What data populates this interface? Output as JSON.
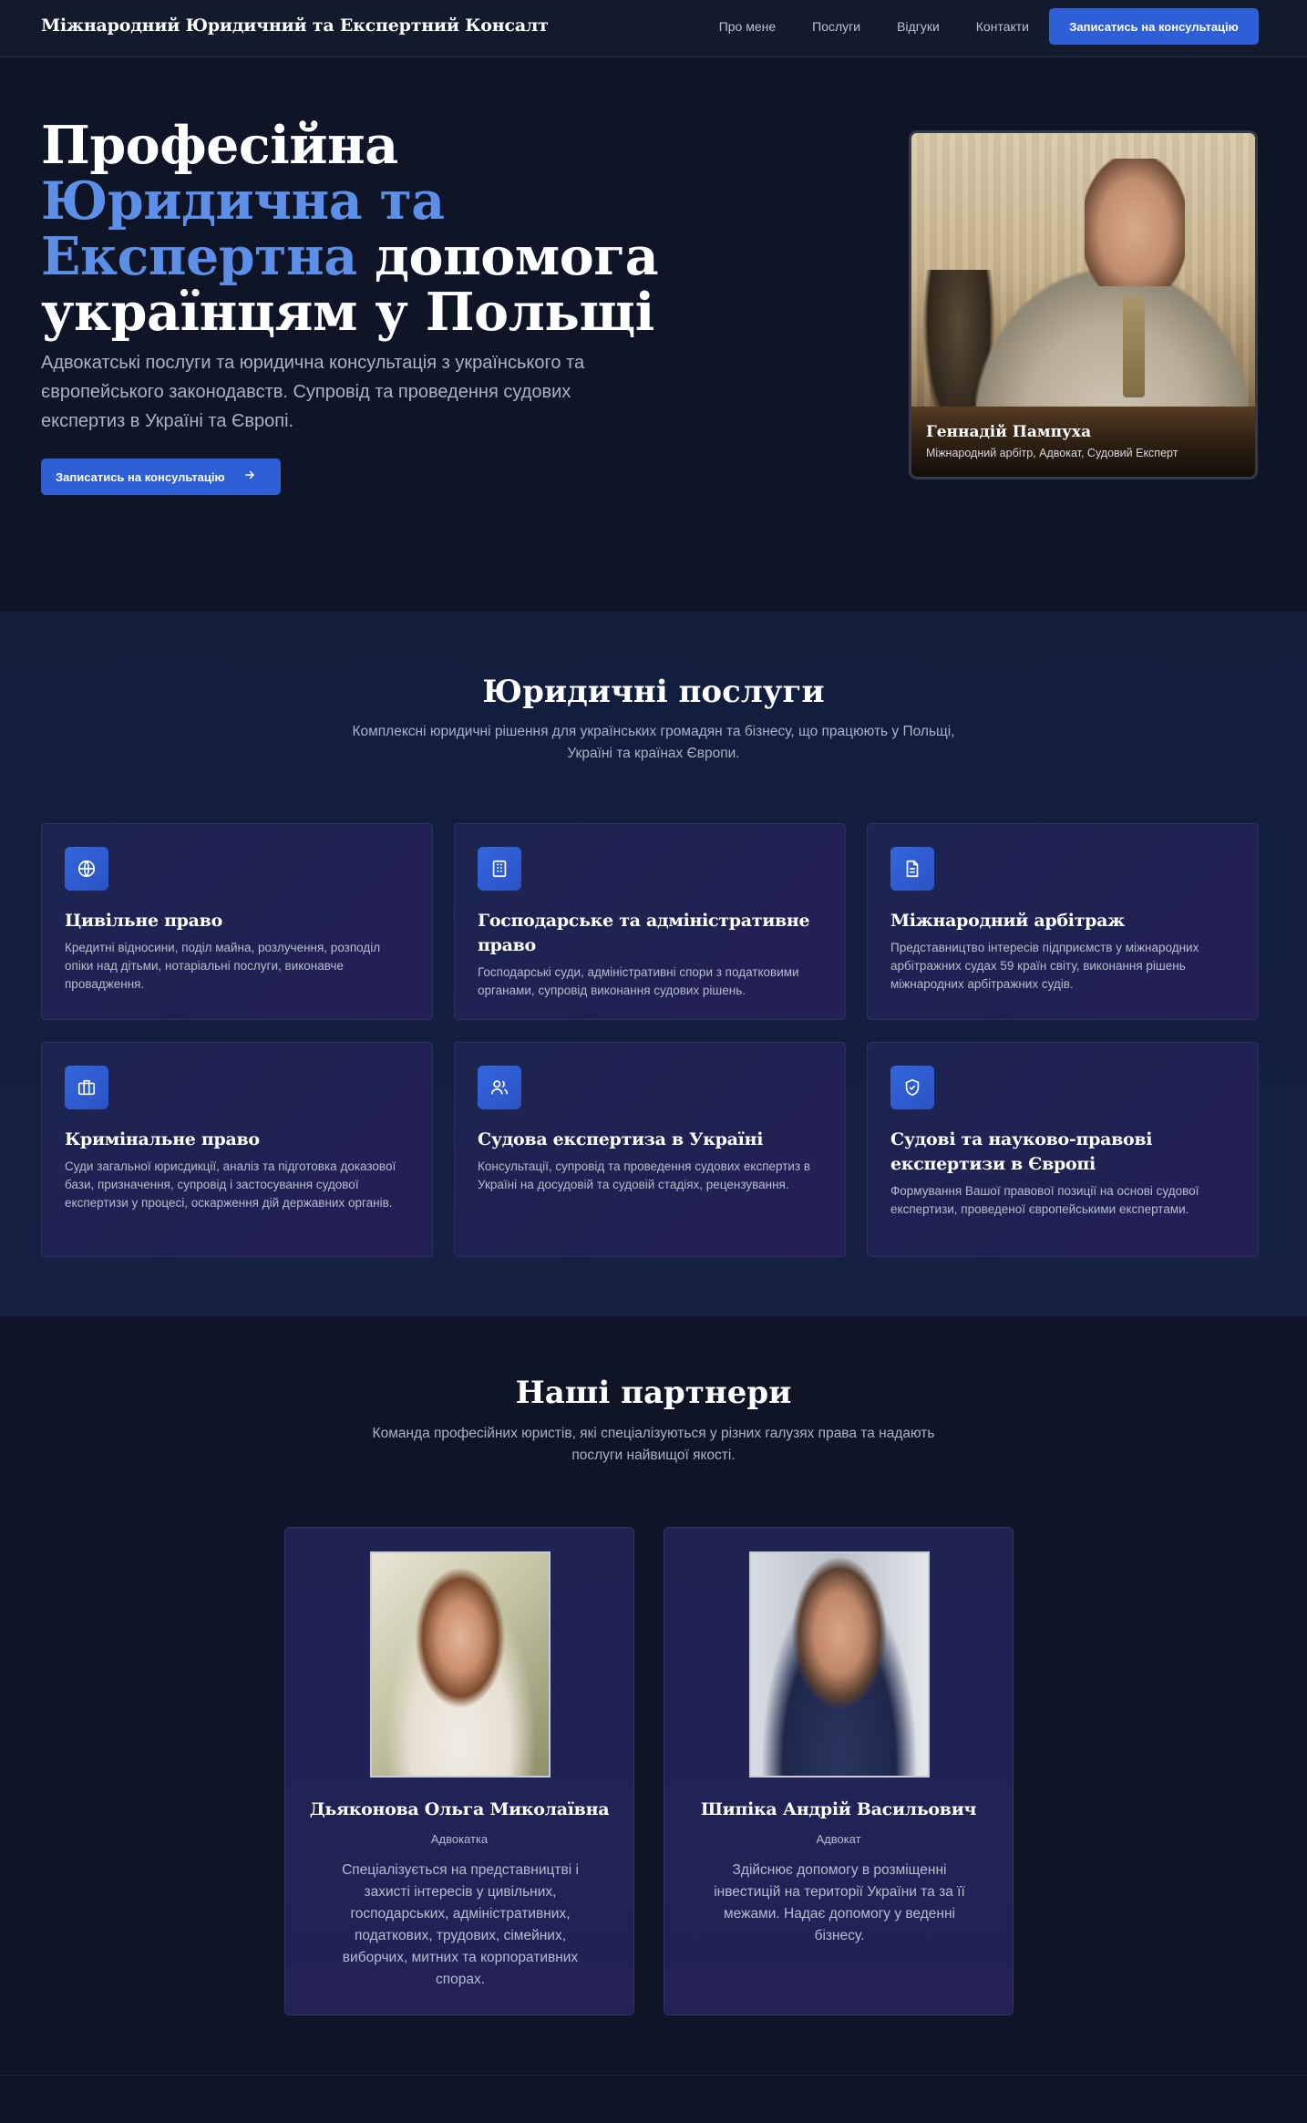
{
  "nav": {
    "brand": "Міжнародний Юридичний та Експертний Консалт",
    "links": [
      "Про мене",
      "Послуги",
      "Відгуки",
      "Контакти"
    ],
    "cta": "Записатись на консультацію"
  },
  "hero": {
    "title_line1": "Професійна",
    "title_accent1": "Юридична та",
    "title_accent2": "Експертна",
    "title_rest2": " допомога",
    "title_line4": "українцям у Польщі",
    "description": "Адвокатські послуги та юридична консультація з українського та європейського законодавств. Супровід та проведення судових експертиз в Україні та Європі.",
    "button": "Записатись на консультацію",
    "button_icon": "arrow-right-icon",
    "portrait_name": "Геннадій Пампуха",
    "portrait_role": "Міжнародний арбітр, Адвокат, Судовий Експерт"
  },
  "services": {
    "title": "Юридичні послуги",
    "subtitle": "Комплексні юридичні рішення для українських громадян та бізнесу, що працюють у Польщі, Україні та країнах Європи.",
    "items": [
      {
        "icon": "globe-icon",
        "title": "Цивільне право",
        "text": "Кредитні відносини, поділ майна, розлучення, розподіл опіки над дітьми, нотаріальні послуги, виконавче провадження."
      },
      {
        "icon": "building-icon",
        "title": "Господарське та адміністративне право",
        "text": "Господарські суди, адміністративні спори з податковими органами, супровід виконання судових рішень."
      },
      {
        "icon": "document-icon",
        "title": "Міжнародний арбітраж",
        "text": "Представництво інтересів підприємств у міжнародних арбітражних судах 59 країн світу, виконання рішень міжнародних арбітражних судів."
      },
      {
        "icon": "briefcase-icon",
        "title": "Кримінальне право",
        "text": "Суди загальної юрисдикції, аналіз та підготовка доказової бази, призначення, супровід і застосування судової експертизи у процесі, оскарження дій державних органів."
      },
      {
        "icon": "users-icon",
        "title": "Судова експертиза в Україні",
        "text": "Консультації, супровід та проведення судових експертиз в Україні на досудовій та судовій стадіях, рецензування."
      },
      {
        "icon": "shield-check-icon",
        "title": "Судові та науково-правові експертизи в Європі",
        "text": "Формування Вашої правової позиції на основі судової експертизи, проведеної європейськими експертами."
      }
    ]
  },
  "partners": {
    "title": "Наші партнери",
    "subtitle": "Команда професійних юристів, які спеціалізуються у різних галузях права та надають послуги найвищої якості.",
    "items": [
      {
        "name": "Дьяконова Ольга Миколаївна",
        "role": "Адвокатка",
        "text": "Спеціалізується на представництві і захисті інтересів у цивільних, господарських, адміністративних, податкових, трудових, сімейних, виборчих, митних та корпоративних спорах."
      },
      {
        "name": "Шипіка Андрій Васильович",
        "role": "Адвокат",
        "text": "Здійснює допомогу в розміщенні інвестицій на території України та за її межами. Надає допомогу у веденні бізнесу."
      }
    ]
  },
  "colors": {
    "accent": "#5b8fe8",
    "button": "#2f5fd6",
    "background": "#0f1526",
    "services_bg": "#131f40"
  }
}
